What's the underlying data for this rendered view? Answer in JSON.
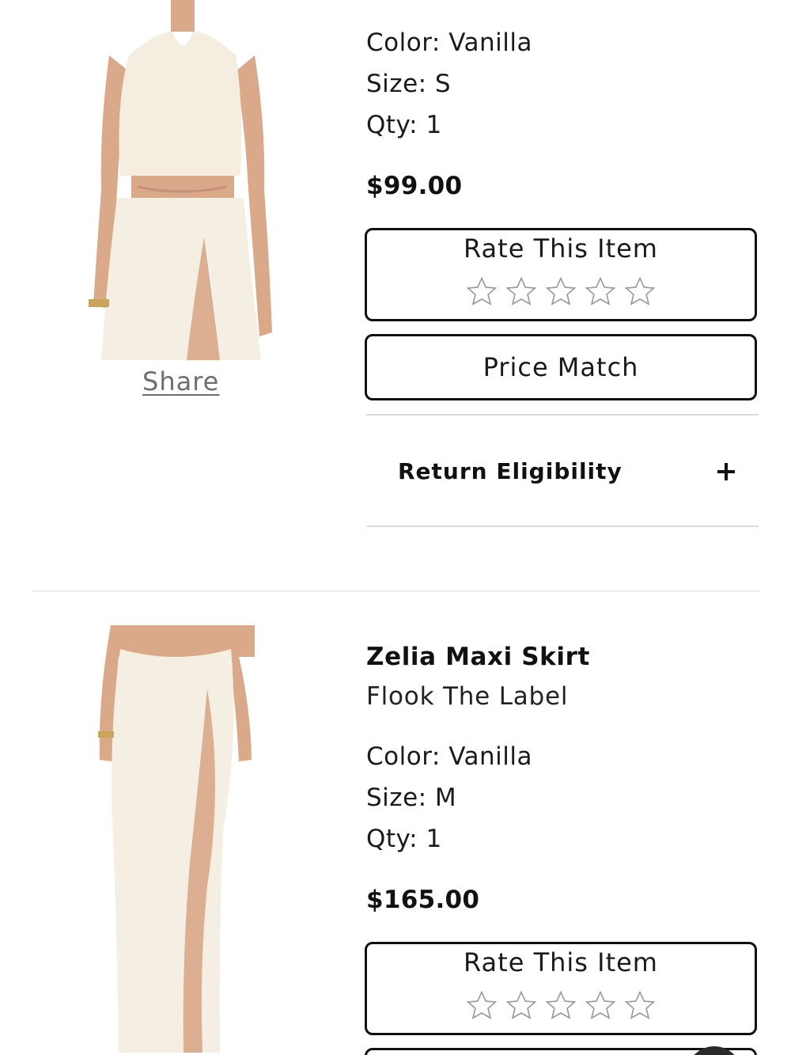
{
  "item1": {
    "image_alt": "Vanilla halter top and wrap skirt outfit",
    "share_label": "Share",
    "color": "Color: Vanilla",
    "size": "Size: S",
    "qty": "Qty: 1",
    "price": "$99.00",
    "rate_label": "Rate This Item",
    "rating": 0,
    "rating_max": 5,
    "price_match_label": "Price Match",
    "return_label": "Return Eligibility",
    "return_icon": "plus-icon"
  },
  "item2": {
    "image_alt": "Zelia Maxi Skirt in vanilla",
    "name": "Zelia Maxi Skirt",
    "brand": "Flook The Label",
    "color": "Color: Vanilla",
    "size": "Size: M",
    "qty": "Qty: 1",
    "price": "$165.00",
    "rate_label": "Rate This Item",
    "rating": 0,
    "rating_max": 5
  },
  "colors": {
    "text": "#111111",
    "link": "#6e6e6e",
    "divider": "#d9d9d9",
    "garment": "#f3ecdd",
    "skin": "#d9a98a"
  }
}
